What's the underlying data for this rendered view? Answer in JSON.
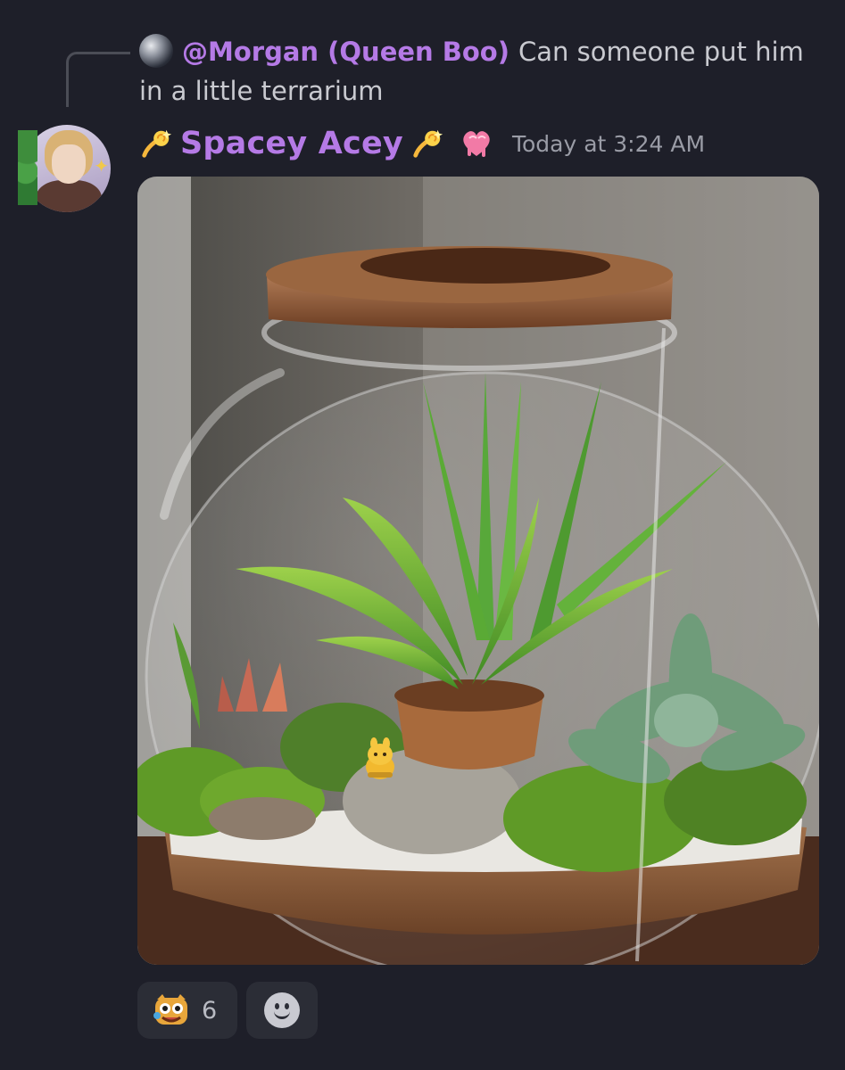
{
  "reply": {
    "author": "@Morgan (Queen Boo)",
    "text": "Can someone put him in a little terrarium"
  },
  "message": {
    "author": "Spacey Acey",
    "timestamp": "Today at 3:24 AM",
    "author_color": "#b57ae6",
    "decorations": [
      "dizzy-emoji",
      "dizzy-emoji",
      "melting-heart-emoji"
    ]
  },
  "attachment": {
    "kind": "image",
    "subject": "glass jar terrarium with wooden lid, plants, moss, stones and a small yellow creature"
  },
  "reactions": [
    {
      "emoji": "custom-emoji",
      "count": "6"
    },
    {
      "emoji": "add-reaction-icon"
    }
  ]
}
